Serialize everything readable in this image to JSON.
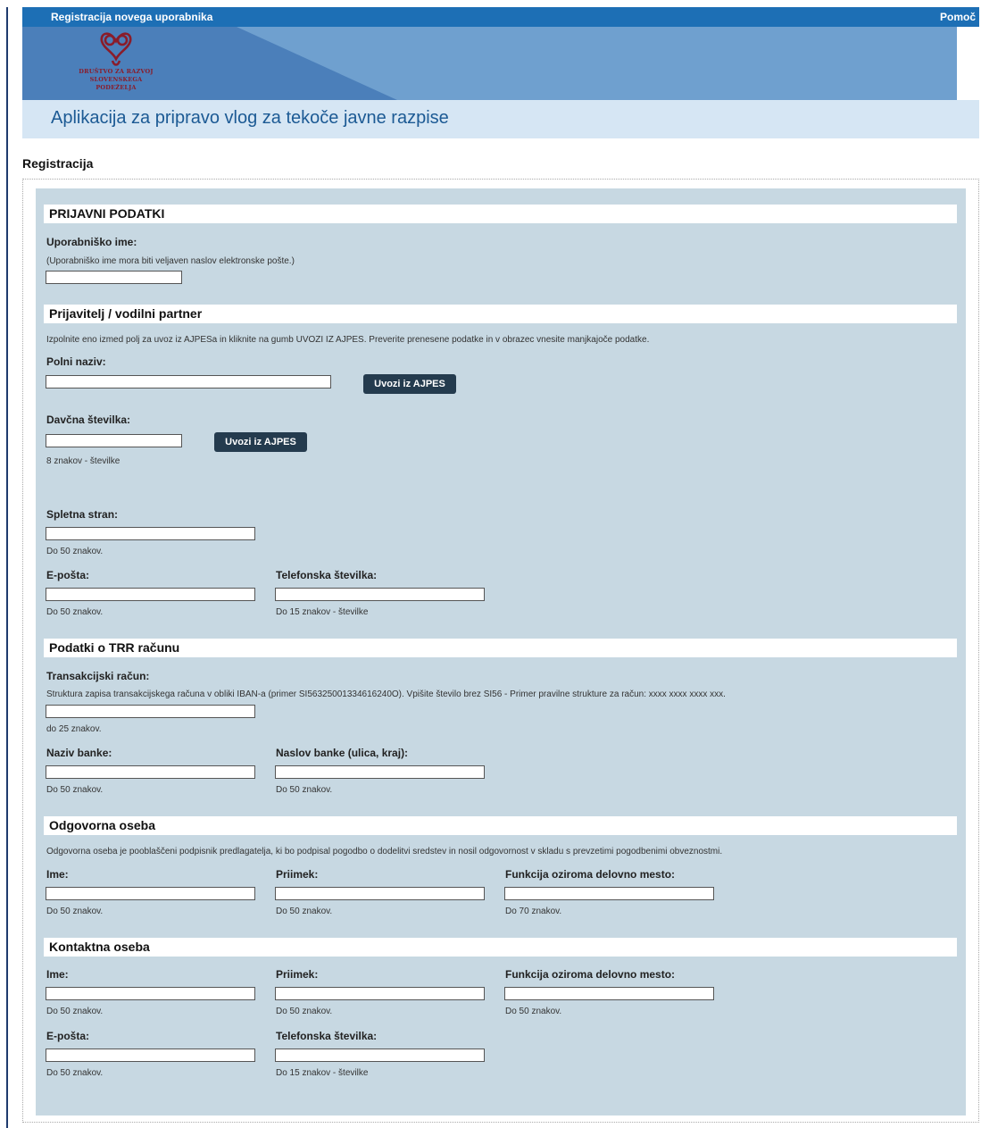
{
  "topbar": {
    "title": "Registracija novega uporabnika",
    "help": "Pomoč"
  },
  "logo": {
    "org_line1": "DRUŠTVO ZA RAZVOJ",
    "org_line2": "SLOVENSKEGA PODEŽELJA"
  },
  "app_title": "Aplikacija za pripravo vlog za tekoče javne razpise",
  "page_title": "Registracija",
  "sec1": {
    "heading": "PRIJAVNI PODATKI",
    "username_label": "Uporabniško ime:",
    "username_hint": "(Uporabniško ime mora biti veljaven naslov elektronske pošte.)",
    "username_value": ""
  },
  "sec2": {
    "heading": "Prijavitelj / vodilni partner",
    "intro": "Izpolnite eno izmed polj za uvoz iz AJPESa in kliknite na gumb UVOZI IZ AJPES. Preverite prenesene podatke in v obrazec vnesite manjkajoče podatke.",
    "full_name_label": "Polni naziv:",
    "import_btn": "Uvozi iz AJPES",
    "tax_label": "Davčna številka:",
    "tax_hint": "8 znakov - številke",
    "web_label": "Spletna stran:",
    "web_hint": "Do 50 znakov.",
    "email_label": "E-pošta:",
    "email_hint": "Do 50 znakov.",
    "phone_label": "Telefonska številka:",
    "phone_hint": "Do 15 znakov - številke"
  },
  "sec3": {
    "heading": "Podatki o TRR računu",
    "account_label": "Transakcijski račun:",
    "account_desc": "Struktura zapisa transakcijskega računa v obliki IBAN-a (primer SI56325001334616240O). Vpišite število brez SI56 - Primer pravilne strukture za račun: xxxx xxxx xxxx xxx.",
    "account_hint": "do 25 znakov.",
    "bank_name_label": "Naziv banke:",
    "bank_name_hint": "Do 50 znakov.",
    "bank_addr_label": "Naslov banke (ulica, kraj):",
    "bank_addr_hint": "Do 50 znakov."
  },
  "sec4": {
    "heading": "Odgovorna oseba",
    "intro": "Odgovorna oseba je pooblaščeni podpisnik predlagatelja, ki bo podpisal pogodbo o dodelitvi sredstev in nosil odgovornost v skladu s prevzetimi pogodbenimi obveznostmi.",
    "first_label": "Ime:",
    "first_hint": "Do 50 znakov.",
    "last_label": "Priimek:",
    "last_hint": "Do 50 znakov.",
    "role_label": "Funkcija oziroma delovno mesto:",
    "role_hint": "Do 70 znakov."
  },
  "sec5": {
    "heading": "Kontaktna oseba",
    "first_label": "Ime:",
    "first_hint": "Do 50 znakov.",
    "last_label": "Priimek:",
    "last_hint": "Do 50 znakov.",
    "role_label": "Funkcija oziroma delovno mesto:",
    "role_hint": "Do 50 znakov.",
    "email_label": "E-pošta:",
    "email_hint": "Do 50 znakov.",
    "phone_label": "Telefonska številka:",
    "phone_hint": "Do 15 znakov - številke"
  },
  "colors": {
    "topbar": "#1d6fb5",
    "banner": "#6fa0cf",
    "panel": "#c7d8e2",
    "title": "#1c5a94",
    "button": "#243b4e"
  }
}
